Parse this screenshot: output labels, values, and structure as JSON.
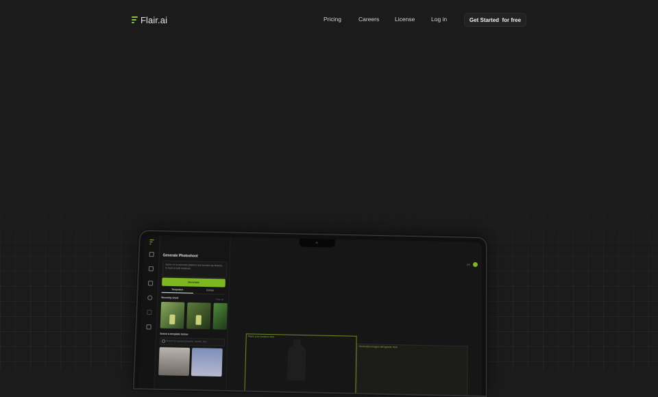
{
  "nav": {
    "logo_text": "Flair.ai",
    "links": [
      "Pricing",
      "Careers",
      "License",
      "Log in"
    ],
    "cta_label": "Get Started  for free"
  },
  "app": {
    "panel_title": "Generate Photoshoot",
    "prompt_text": "Some on a concrete platform surrounded by flowers, in front of soft shadows",
    "generate_label": "Generate",
    "tabs": [
      "Templates",
      "Extras"
    ],
    "recently_used_label": "Recently Used",
    "view_all_label": "View all",
    "select_template_label": "Select a template below",
    "search_placeholder": "Search by keyword (flowers, 'sunset', etc)",
    "canvas_left_label": "Place your product here",
    "canvas_right_label": "Generated images will appear here",
    "top_right_text": "2/4"
  },
  "colors": {
    "accent": "#7db821",
    "background": "#1b1b1b"
  }
}
